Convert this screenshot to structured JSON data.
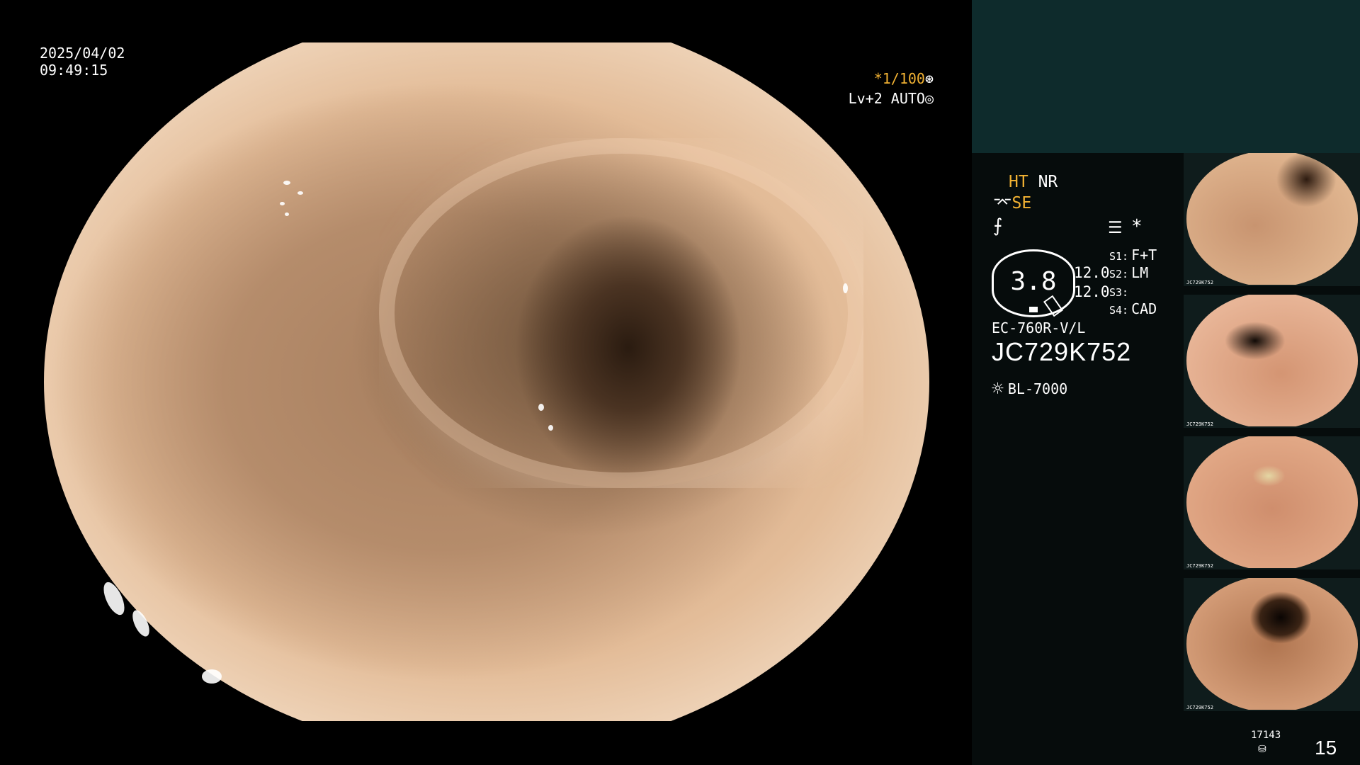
{
  "overlay": {
    "date": "2025/04/02",
    "time": "09:49:15",
    "shutter_prefix": "*",
    "shutter_value": "1/100",
    "shutter_icon": "aperture-icon",
    "level": "Lv+2 AUTO",
    "level_icon": "iris-icon"
  },
  "info": {
    "ht": "HT",
    "nr": "NR",
    "se": "SE",
    "asterisk": "*",
    "gauge_value": "3.8",
    "value_1": "12.0",
    "value_2": "12.0",
    "s_slots": [
      {
        "key": "S1:",
        "value": "F+T"
      },
      {
        "key": "S2:",
        "value": "LM"
      },
      {
        "key": "S3:",
        "value": ""
      },
      {
        "key": "S4:",
        "value": "CAD"
      }
    ],
    "scope_model": "EC-760R-V/L",
    "scope_serial": "JC729K752",
    "light_source": "BL-7000",
    "counter": "17143",
    "page_number": "15"
  },
  "thumbnails": [
    {
      "caption": "JC729K752"
    },
    {
      "caption": "JC729K752"
    },
    {
      "caption": "JC729K752"
    },
    {
      "caption": "JC729K752"
    }
  ],
  "colors": {
    "accent_amber": "#f2b233",
    "panel_bg": "#060c0c",
    "panel_top_box": "#0e2b2c"
  }
}
